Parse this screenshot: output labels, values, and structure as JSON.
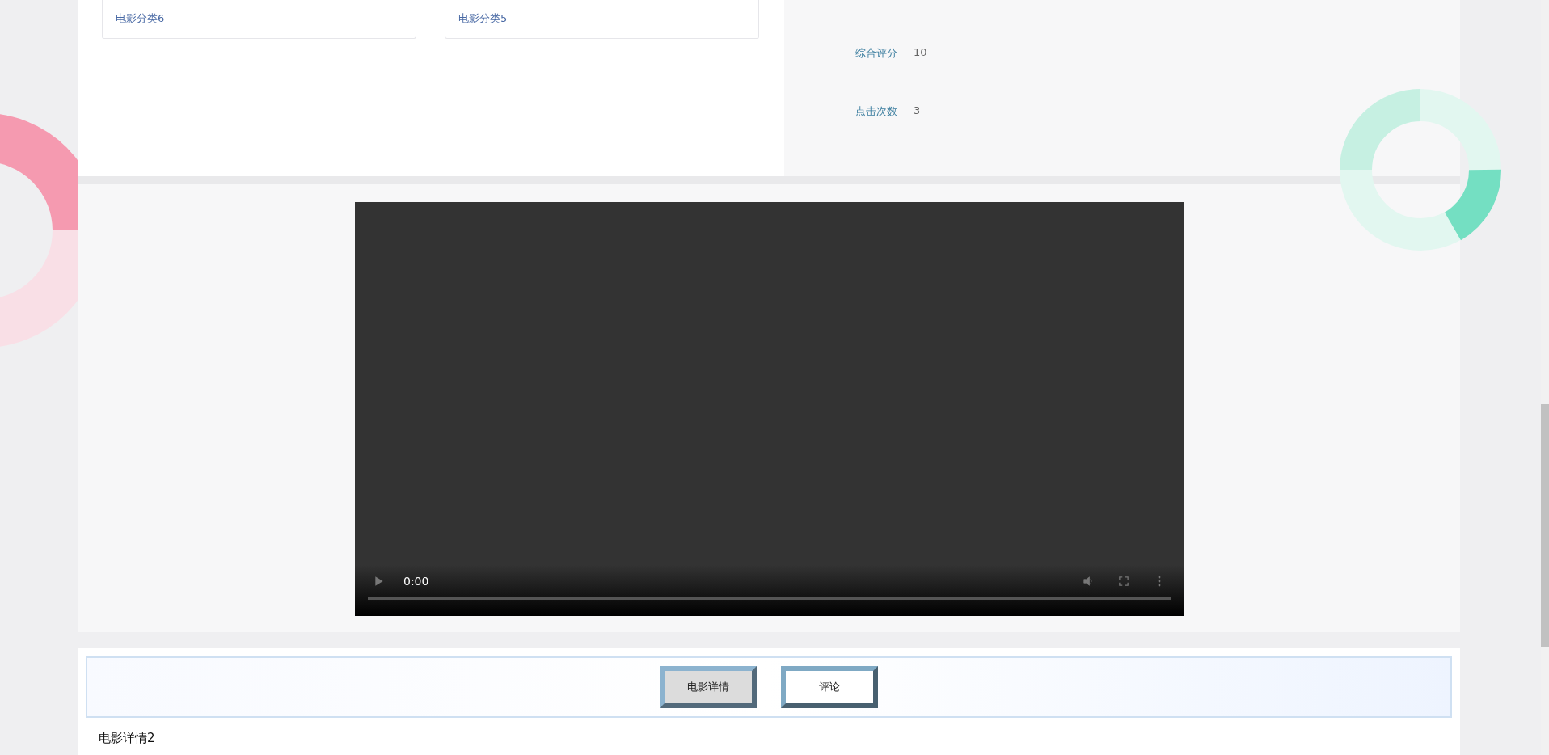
{
  "categories": [
    {
      "label": "电影分类6"
    },
    {
      "label": "电影分类5"
    }
  ],
  "details": [
    {
      "label": "综合评分",
      "value": "10"
    },
    {
      "label": "点击次数",
      "value": "3"
    }
  ],
  "video": {
    "time": "0:00"
  },
  "tabs": [
    {
      "label": "电影详情",
      "selected": true
    },
    {
      "label": "评论",
      "selected": false
    }
  ],
  "content": "电影详情2"
}
